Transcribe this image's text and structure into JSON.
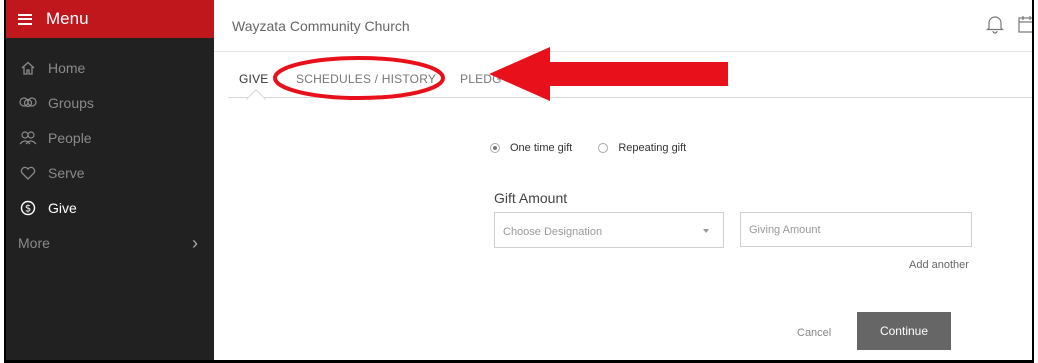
{
  "sidebar": {
    "menu_label": "Menu",
    "items": [
      {
        "label": "Home",
        "icon": "home-icon"
      },
      {
        "label": "Groups",
        "icon": "groups-icon"
      },
      {
        "label": "People",
        "icon": "people-icon"
      },
      {
        "label": "Serve",
        "icon": "heart-icon"
      },
      {
        "label": "Give",
        "icon": "dollar-circle-icon"
      }
    ],
    "more_label": "More",
    "active_item": "Give"
  },
  "header": {
    "org_title": "Wayzata Community Church"
  },
  "tabs": [
    {
      "label": "GIVE"
    },
    {
      "label": "SCHEDULES / HISTORY"
    },
    {
      "label": "PLEDG"
    }
  ],
  "form": {
    "gift_types": [
      {
        "label": "One time gift",
        "checked": true
      },
      {
        "label": "Repeating gift",
        "checked": false
      }
    ],
    "gift_amount_label": "Gift Amount",
    "designation_placeholder": "Choose Designation",
    "amount_placeholder": "Giving Amount",
    "add_another_label": "Add another",
    "cancel_label": "Cancel",
    "continue_label": "Continue"
  },
  "colors": {
    "brand_red": "#c0171c",
    "annotation_red": "#e8101a",
    "sidebar_bg": "#212121",
    "button_gray": "#666666"
  }
}
